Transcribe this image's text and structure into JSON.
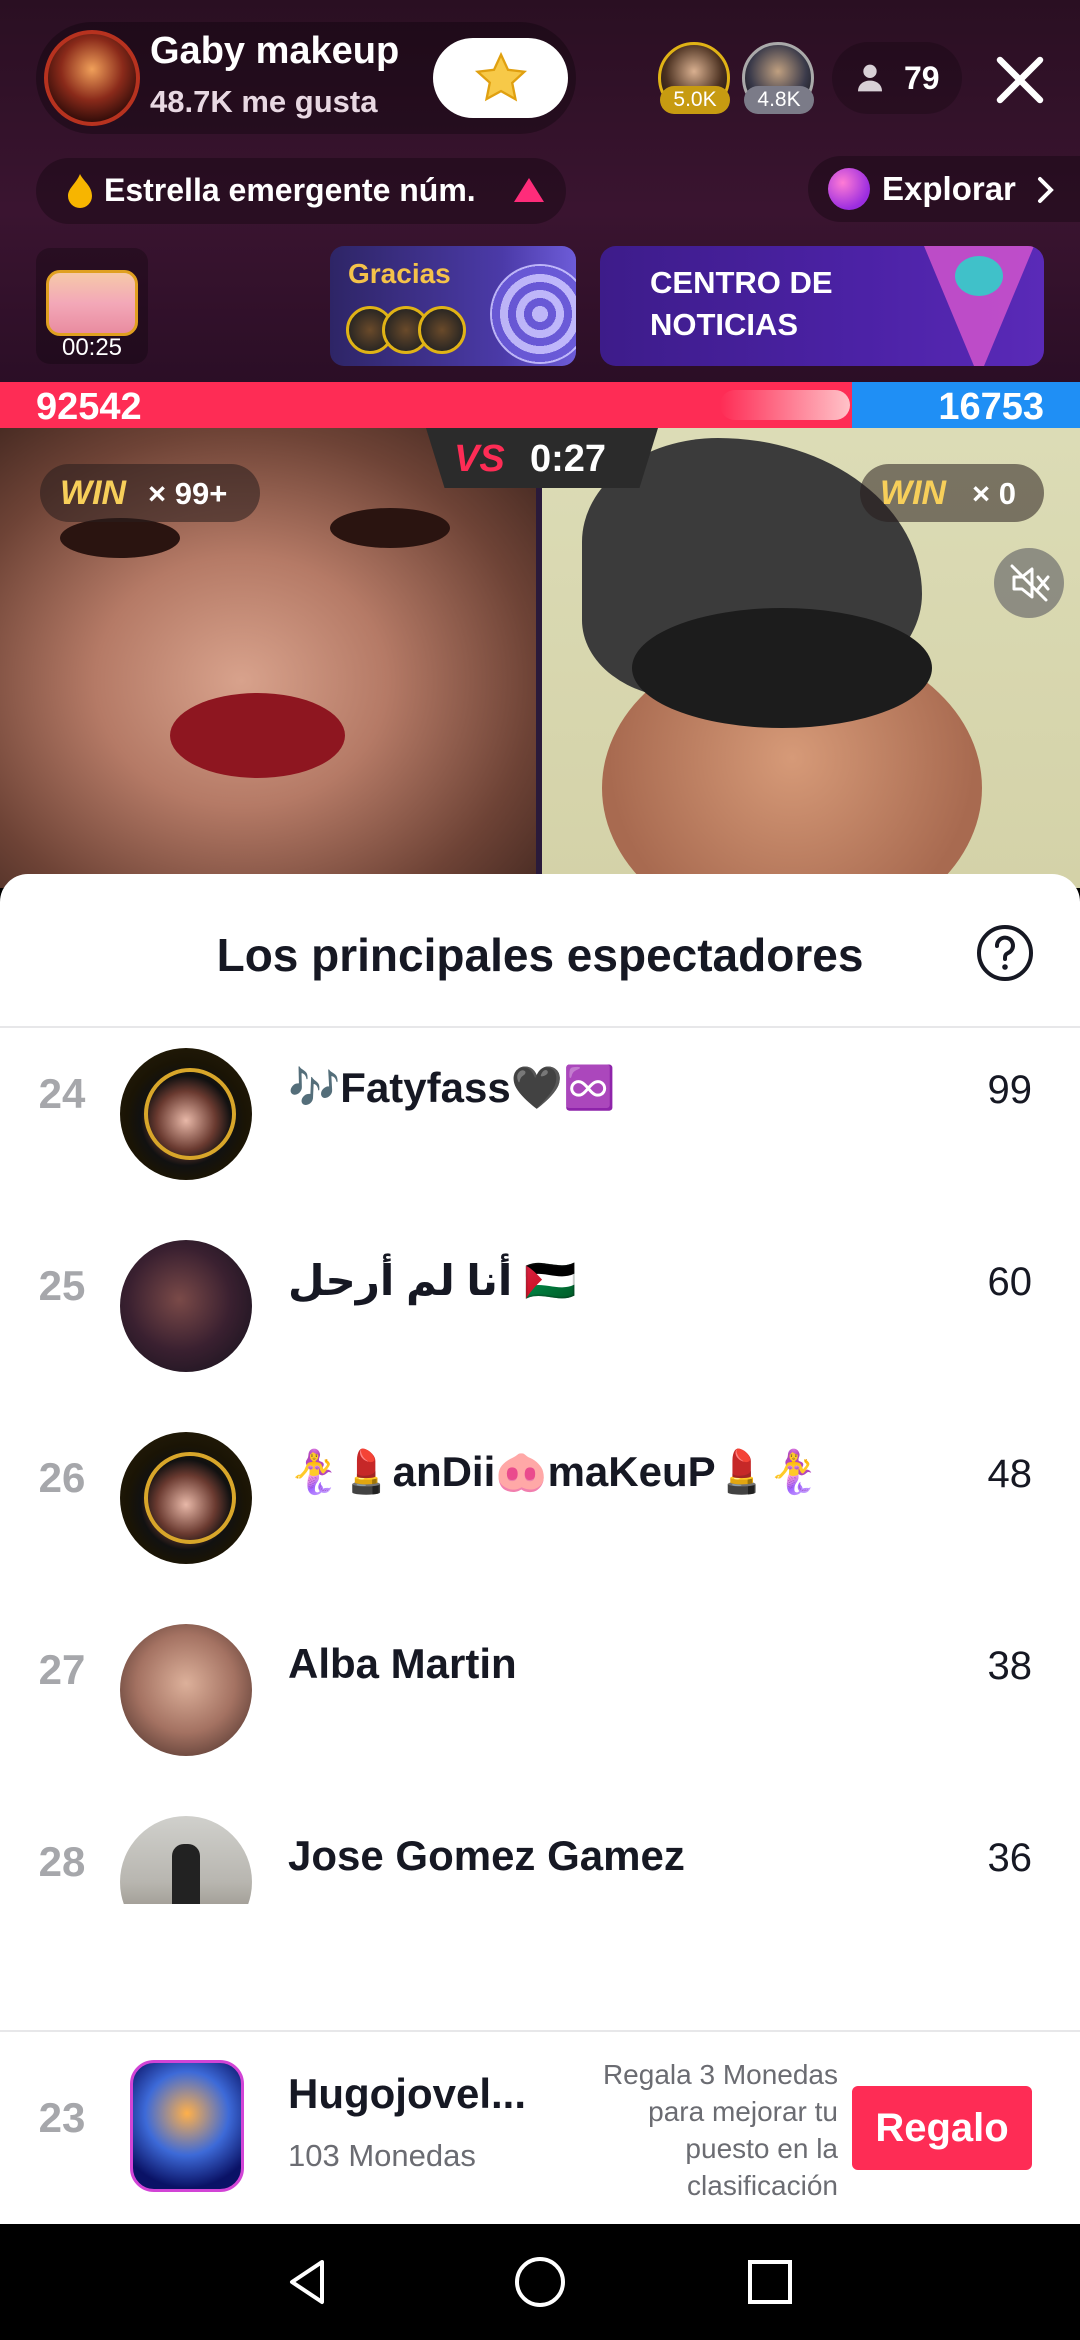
{
  "host": {
    "name": "Gaby makeup",
    "likes": "48.7K me gusta"
  },
  "top_viewers": [
    {
      "badge": "5.0K"
    },
    {
      "badge": "4.8K"
    }
  ],
  "viewer_count": "79",
  "rank_pill": {
    "label": "Estrella emergente núm."
  },
  "explore": {
    "label": "Explorar"
  },
  "treasure": {
    "timer": "00:25"
  },
  "thanks_banner": {
    "label": "Gracias"
  },
  "news_banner": {
    "label": "CENTRO DE NOTICIAS"
  },
  "battle": {
    "left_score": "92542",
    "right_score": "16753",
    "timer": "0:27",
    "vs": "VS",
    "win_label": "WIN",
    "left_wins": "× 99+",
    "right_wins": "× 0",
    "colors": {
      "left": "#fe2c55",
      "right": "#1f8ff5"
    }
  },
  "sheet": {
    "title": "Los principales espectadores",
    "rows": [
      {
        "rank": "24",
        "name": "🎶Fatyfass🖤♾️",
        "score": "99"
      },
      {
        "rank": "25",
        "name": "أنا لم أرحل 🇵🇸",
        "score": "60"
      },
      {
        "rank": "26",
        "name": "🧜‍♀️💄anDii🐽maKeuP💄🧜‍♀️",
        "score": "48"
      },
      {
        "rank": "27",
        "name": "Alba Martin",
        "score": "38"
      },
      {
        "rank": "28",
        "name": "Jose Gomez Gamez",
        "score": "36"
      }
    ]
  },
  "me": {
    "rank": "23",
    "name": "Hugojovel...",
    "coins": "103 Monedas",
    "hint": "Regala 3 Monedas para mejorar tu puesto en la clasificación",
    "gift_button": "Regalo"
  },
  "icons": [
    "star-icon",
    "person-icon",
    "close-icon",
    "flame-icon",
    "triangle-up-icon",
    "planet-icon",
    "chevron-right-icon",
    "treasure-chest-icon",
    "mute-icon",
    "help-icon",
    "nav-back-icon",
    "nav-home-icon",
    "nav-recents-icon"
  ],
  "accent_color": "#fe2c55"
}
